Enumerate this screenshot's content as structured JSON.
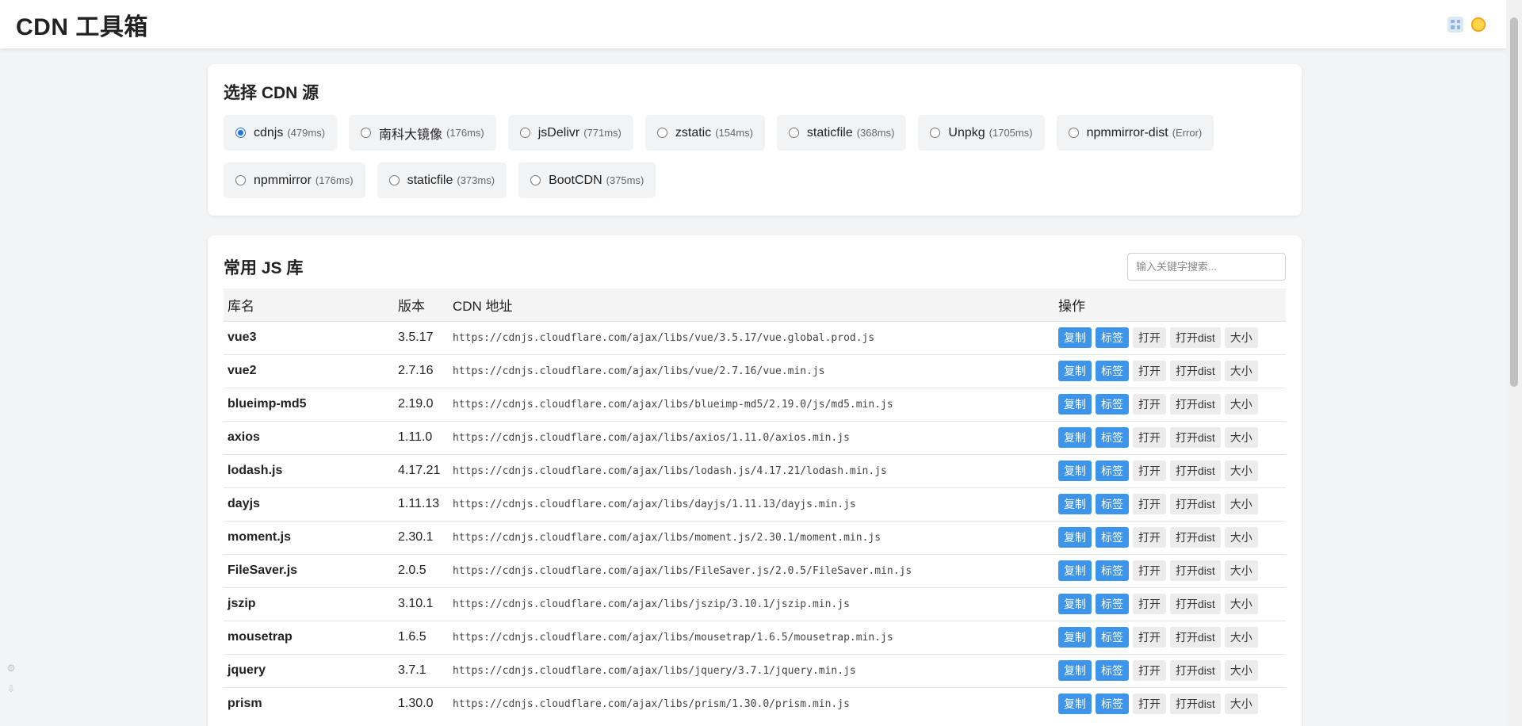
{
  "header": {
    "title": "CDN 工具箱",
    "icons": [
      "grid-icon",
      "sun-icon"
    ]
  },
  "sources": {
    "title": "选择 CDN 源",
    "selected": "cdnjs",
    "items": [
      {
        "name": "cdnjs",
        "latency": "(479ms)",
        "checked": true
      },
      {
        "name": "南科大镜像",
        "latency": "(176ms)",
        "checked": false
      },
      {
        "name": "jsDelivr",
        "latency": "(771ms)",
        "checked": false
      },
      {
        "name": "zstatic",
        "latency": "(154ms)",
        "checked": false
      },
      {
        "name": "staticfile",
        "latency": "(368ms)",
        "checked": false
      },
      {
        "name": "Unpkg",
        "latency": "(1705ms)",
        "checked": false
      },
      {
        "name": "npmmirror-dist",
        "latency": "(Error)",
        "checked": false
      },
      {
        "name": "npmmirror",
        "latency": "(176ms)",
        "checked": false
      },
      {
        "name": "staticfile",
        "latency": "(373ms)",
        "checked": false
      },
      {
        "name": "BootCDN",
        "latency": "(375ms)",
        "checked": false
      }
    ]
  },
  "libraries": {
    "title": "常用 JS 库",
    "search_placeholder": "输入关键字搜索...",
    "columns": [
      "库名",
      "版本",
      "CDN 地址",
      "操作"
    ],
    "actions": [
      "复制",
      "标签",
      "打开",
      "打开dist",
      "大小"
    ],
    "rows": [
      {
        "name": "vue3",
        "version": "3.5.17",
        "url": "https://cdnjs.cloudflare.com/ajax/libs/vue/3.5.17/vue.global.prod.js"
      },
      {
        "name": "vue2",
        "version": "2.7.16",
        "url": "https://cdnjs.cloudflare.com/ajax/libs/vue/2.7.16/vue.min.js"
      },
      {
        "name": "blueimp-md5",
        "version": "2.19.0",
        "url": "https://cdnjs.cloudflare.com/ajax/libs/blueimp-md5/2.19.0/js/md5.min.js"
      },
      {
        "name": "axios",
        "version": "1.11.0",
        "url": "https://cdnjs.cloudflare.com/ajax/libs/axios/1.11.0/axios.min.js"
      },
      {
        "name": "lodash.js",
        "version": "4.17.21",
        "url": "https://cdnjs.cloudflare.com/ajax/libs/lodash.js/4.17.21/lodash.min.js"
      },
      {
        "name": "dayjs",
        "version": "1.11.13",
        "url": "https://cdnjs.cloudflare.com/ajax/libs/dayjs/1.11.13/dayjs.min.js"
      },
      {
        "name": "moment.js",
        "version": "2.30.1",
        "url": "https://cdnjs.cloudflare.com/ajax/libs/moment.js/2.30.1/moment.min.js"
      },
      {
        "name": "FileSaver.js",
        "version": "2.0.5",
        "url": "https://cdnjs.cloudflare.com/ajax/libs/FileSaver.js/2.0.5/FileSaver.min.js"
      },
      {
        "name": "jszip",
        "version": "3.10.1",
        "url": "https://cdnjs.cloudflare.com/ajax/libs/jszip/3.10.1/jszip.min.js"
      },
      {
        "name": "mousetrap",
        "version": "1.6.5",
        "url": "https://cdnjs.cloudflare.com/ajax/libs/mousetrap/1.6.5/mousetrap.min.js"
      },
      {
        "name": "jquery",
        "version": "3.7.1",
        "url": "https://cdnjs.cloudflare.com/ajax/libs/jquery/3.7.1/jquery.min.js"
      },
      {
        "name": "prism",
        "version": "1.30.0",
        "url": "https://cdnjs.cloudflare.com/ajax/libs/prism/1.30.0/prism.min.js"
      }
    ]
  },
  "colors": {
    "accent": "#3d95eb",
    "radio_checked": "#1a73e8",
    "background": "#f3f4f6"
  }
}
